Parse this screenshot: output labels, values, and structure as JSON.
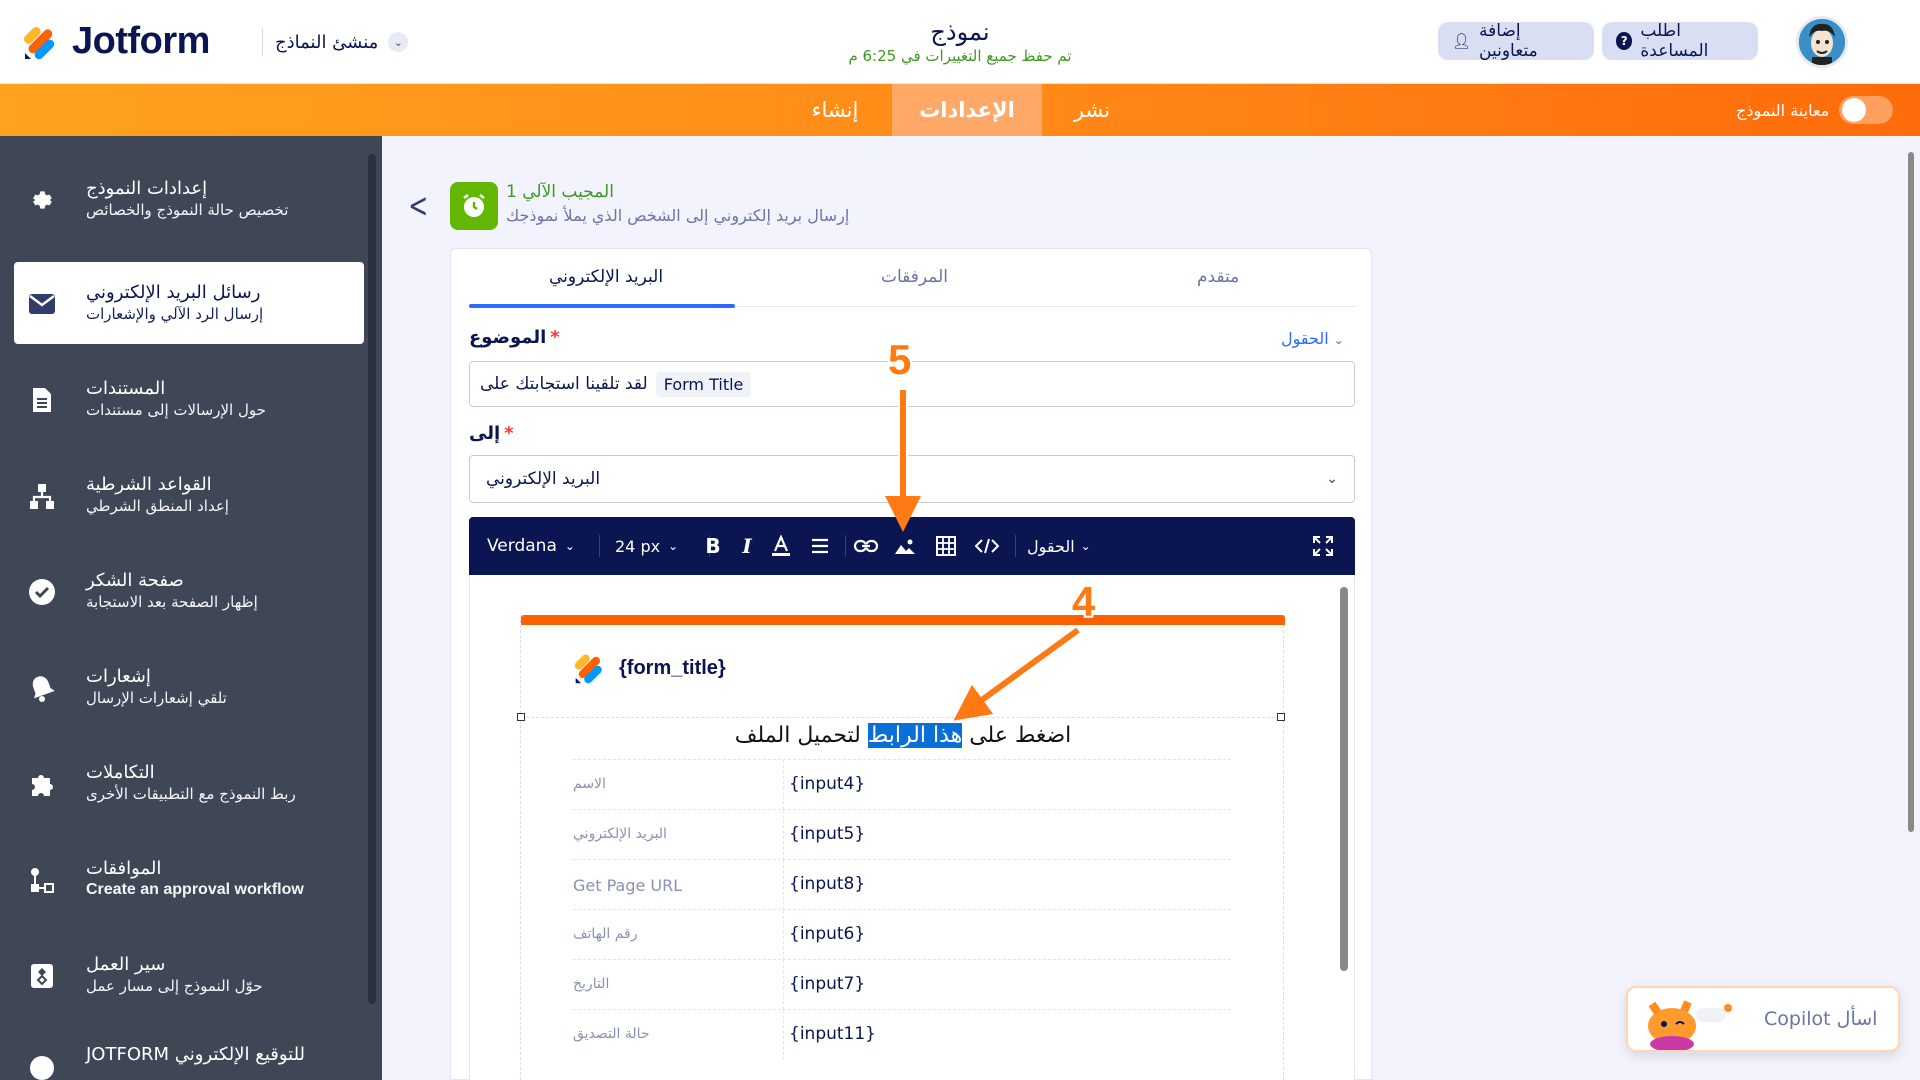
{
  "brand": {
    "name": "Jotform"
  },
  "header": {
    "builder_label": "منشئ النماذج",
    "form_name": "نموذج",
    "save_status": "تم حفظ جميع التغييرات في 6:25 م",
    "help_label": "اطلب المساعدة",
    "collab_label": "إضافة متعاونين"
  },
  "nav": {
    "tabs": [
      {
        "label": "إنشاء"
      },
      {
        "label": "الإعدادات"
      },
      {
        "label": "نشر"
      }
    ],
    "active_tab": "الإعدادات",
    "preview_label": "معاينة النموذج",
    "preview_on": false
  },
  "sidebar": {
    "items": [
      {
        "title": "إعدادات النموذج",
        "subtitle": "تخصيص حالة النموذج والخصائص",
        "icon": "gear-icon"
      },
      {
        "title": "رسائل البريد الإلكتروني",
        "subtitle": "إرسال الرد الآلي والإشعارات",
        "icon": "envelope-icon",
        "active": true
      },
      {
        "title": "المستندات",
        "subtitle": "حول الإرسالات إلى مستندات",
        "icon": "document-icon"
      },
      {
        "title": "القواعد الشرطية",
        "subtitle": "إعداد المنطق الشرطي",
        "icon": "sitemap-icon"
      },
      {
        "title": "صفحة الشكر",
        "subtitle": "إظهار الصفحة بعد الاستجابة",
        "icon": "check-circle-icon"
      },
      {
        "title": "إشعارات",
        "subtitle": "تلقي إشعارات الإرسال",
        "icon": "bell-icon"
      },
      {
        "title": "التكاملات",
        "subtitle": "ربط النموذج مع التطبيقات الأخرى",
        "icon": "puzzle-icon"
      },
      {
        "title": "الموافقات",
        "subtitle": "Create an approval workflow",
        "icon": "approval-flow-icon"
      },
      {
        "title": "سير العمل",
        "subtitle": "حوّل النموذج إلى مسار عمل",
        "icon": "workflow-icon"
      },
      {
        "title": "JOTFORM للتوقيع الإلكتروني",
        "subtitle": "",
        "icon": "sign-icon"
      }
    ]
  },
  "autoresponder": {
    "title": "المجيب الآلي 1",
    "description": "إرسال بريد إلكتروني إلى الشخص الذي يملأ نموذجك"
  },
  "panel_tabs": [
    "متقدم",
    "المرفقات",
    "البريد الإلكتروني"
  ],
  "subject": {
    "label": "الموضوع",
    "required_mark": "*",
    "fields_link": "الحقول",
    "tag": "Form Title",
    "text": "لقد تلقينا استجابتك على"
  },
  "recipient": {
    "label": "إلى",
    "required_mark": "*",
    "value": "البريد الإلكتروني"
  },
  "toolbar": {
    "font": "Verdana",
    "size": "24 px",
    "fields_label": "الحقول"
  },
  "email_body": {
    "header_title": "{form_title}",
    "link_sentence_before": "اضغط على",
    "link_highlight": "هذا الرابط",
    "link_sentence_after": "لتحميل الملف",
    "rows": [
      {
        "key": "الاسم",
        "value": "{input4}"
      },
      {
        "key": "البريد الإلكتروني",
        "value": "{input5}"
      },
      {
        "key": "Get Page URL",
        "value": "{input8}"
      },
      {
        "key": "رقم الهاتف",
        "value": "{input6}"
      },
      {
        "key": "التاريخ",
        "value": "{input7}"
      },
      {
        "key": "حالة التصديق",
        "value": "{input11}"
      }
    ],
    "accent_color": "#ff6100"
  },
  "annotations": {
    "step_4": "4",
    "step_5": "5",
    "color": "#ff7a12"
  },
  "copilot": {
    "label": "اسأل Copilot"
  },
  "colors": {
    "navy": "#0a1551",
    "orange": "#ff8b18",
    "green": "#64b700",
    "link_blue": "#2e69ff"
  }
}
